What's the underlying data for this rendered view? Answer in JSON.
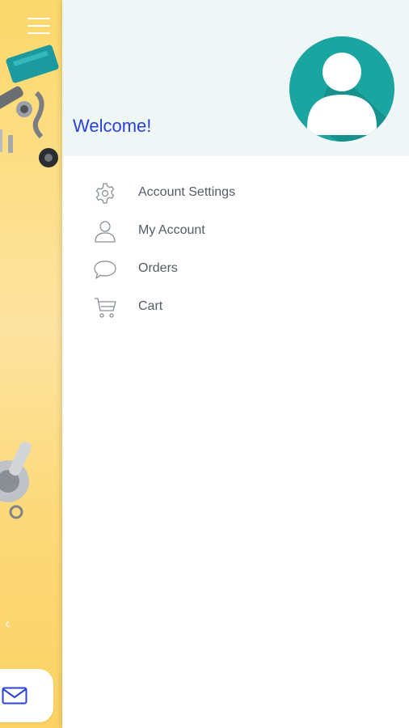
{
  "drawer": {
    "welcome_text": "Welcome!",
    "menu": [
      {
        "label": "Account Settings",
        "icon": "gear-icon"
      },
      {
        "label": "My Account",
        "icon": "user-icon"
      },
      {
        "label": "Orders",
        "icon": "chat-bubble-icon"
      },
      {
        "label": "Cart",
        "icon": "cart-icon"
      }
    ]
  },
  "colors": {
    "accent_text": "#2a43d6",
    "avatar_bg": "#1aa5a0",
    "header_bg": "#eff6f6",
    "background_strip": "#fbd86a"
  }
}
